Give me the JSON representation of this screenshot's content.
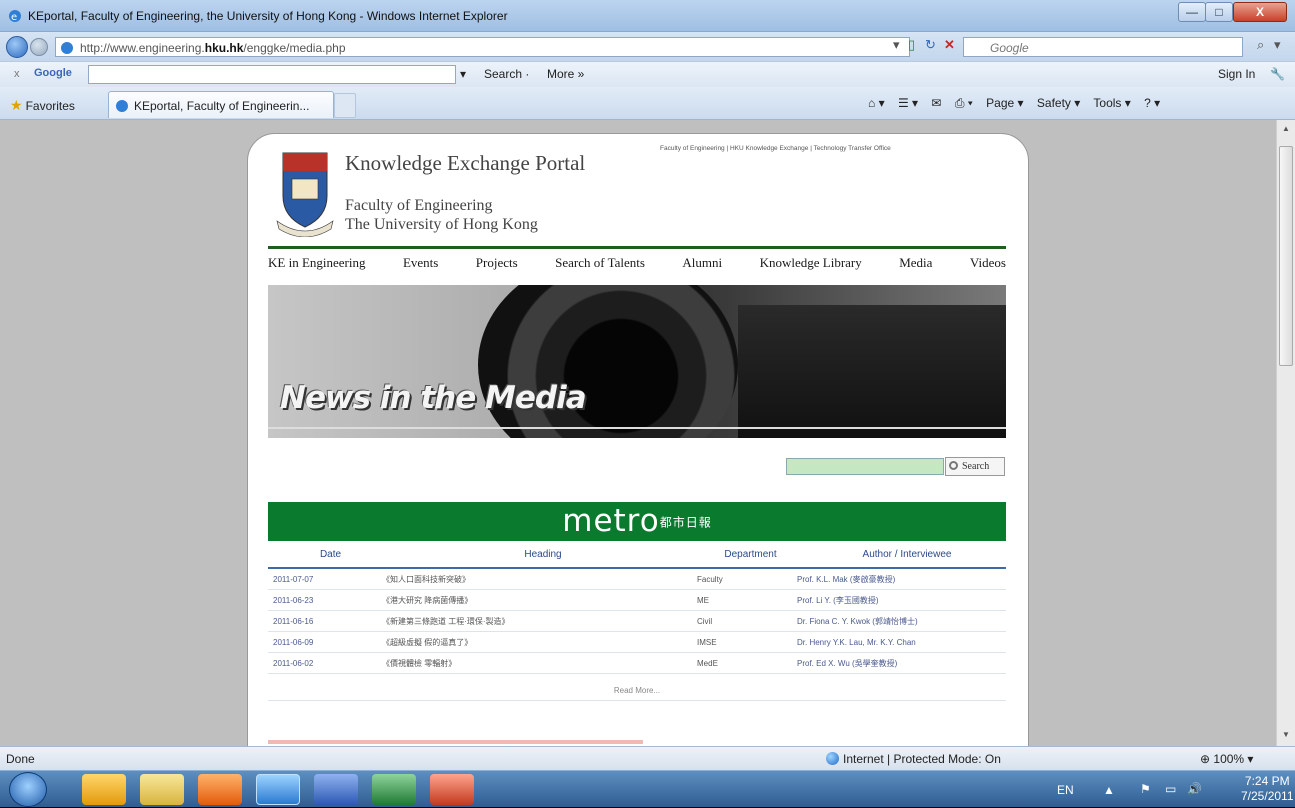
{
  "window": {
    "title": "KEportal, Faculty of Engineering, the University of Hong Kong - Windows Internet Explorer",
    "min": "—",
    "max": "□",
    "close": "X"
  },
  "address": {
    "url_prefix": "http://www.engineering.",
    "url_domain": "hku.hk",
    "url_path": "/enggke/media.php",
    "search_placeholder": "Google"
  },
  "google_toolbar": {
    "close": "x",
    "logo": "Google",
    "search_label": "Search ·",
    "more_label": "More »",
    "sign_in": "Sign In"
  },
  "favorites_bar": {
    "favorites_label": "Favorites",
    "tab_title": "KEportal, Faculty of Engineerin...",
    "commands": [
      "Page ▾",
      "Safety ▾",
      "Tools ▾"
    ]
  },
  "page": {
    "title": "Knowledge Exchange Portal",
    "faculty_line1": "Faculty of Engineering",
    "faculty_line2": "The University of Hong Kong",
    "top_links": "Faculty of Engineering | HKU Knowledge Exchange | Technology Transfer Office",
    "nav": [
      "KE in Engineering",
      "Events",
      "Projects",
      "Search of Talents",
      "Alumni",
      "Knowledge Library",
      "Media",
      "Videos"
    ],
    "banner_title": "News in the Media",
    "search_button": "Search",
    "metro_logo": "metro",
    "metro_cjk": "都市日報",
    "table_headers": [
      "Date",
      "Heading",
      "Department",
      "Author / Interviewee"
    ],
    "rows": [
      {
        "date": "2011-07-07",
        "heading": "《知人口面科技新突破》",
        "dept": "Faculty",
        "author": "Prof. K.L. Mak (麥啟豪教授)"
      },
      {
        "date": "2011-06-23",
        "heading": "《港大研究 降病菌傳播》",
        "dept": "ME",
        "author": "Prof. Li Y. (李玉國教授)"
      },
      {
        "date": "2011-06-16",
        "heading": "《新建第三條跑道 工程·環保·製造》",
        "dept": "Civil",
        "author": "Dr. Fiona C. Y. Kwok (郭靖怡博士)"
      },
      {
        "date": "2011-06-09",
        "heading": "《超級虛擬 假的逼真了》",
        "dept": "IMSE",
        "author": "Dr. Henry Y.K. Lau, Mr. K.Y. Chan"
      },
      {
        "date": "2011-06-02",
        "heading": "《價視體檢 零輻射》",
        "dept": "MedE",
        "author": "Prof. Ed X. Wu (吳學奎教授)"
      }
    ],
    "read_more": "Read More..."
  },
  "status": {
    "left": "Done",
    "zone": "Internet | Protected Mode: On",
    "zoom": "100%"
  },
  "tray": {
    "lang": "EN",
    "time": "7:24 PM",
    "date": "7/25/2011"
  }
}
